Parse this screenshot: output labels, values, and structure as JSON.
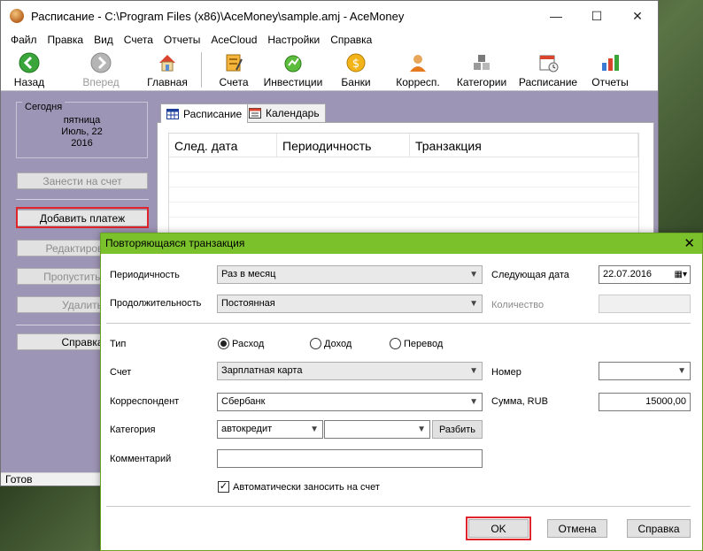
{
  "window": {
    "title": "Расписание - C:\\Program Files (x86)\\AceMoney\\sample.amj - AceMoney",
    "minimize": "—",
    "maximize": "☐",
    "close": "✕"
  },
  "menu": [
    "Файл",
    "Правка",
    "Вид",
    "Счета",
    "Отчеты",
    "AceCloud",
    "Настройки",
    "Справка"
  ],
  "toolbar": {
    "back": "Назад",
    "forward": "Вперед",
    "home": "Главная",
    "accounts": "Счета",
    "investments": "Инвестиции",
    "banks": "Банки",
    "payees": "Корресп.",
    "categories": "Категории",
    "schedule": "Расписание",
    "reports": "Отчеты"
  },
  "left_panel": {
    "today_label": "Сегодня",
    "weekday": "пятница",
    "date_line": "Июль, 22",
    "year": "2016",
    "enter_button": "Занести на счет",
    "add_payment_button": "Добавить платеж",
    "edit_button": "Редактировать",
    "skip_button": "Пропустить пла",
    "delete_button": "Удалить",
    "help_button": "Справка"
  },
  "tabs": {
    "schedule": "Расписание",
    "calendar": "Календарь"
  },
  "list": {
    "columns": [
      "След. дата",
      "Периодичность",
      "Транзакция"
    ]
  },
  "statusbar": {
    "text": "Готов"
  },
  "dialog": {
    "title": "Повторяющаяся транзакция",
    "close": "✕",
    "periodicity_label": "Периодичность",
    "periodicity_value": "Раз в месяц",
    "duration_label": "Продолжительность",
    "duration_value": "Постоянная",
    "next_date_label": "Следующая дата",
    "next_date_value": "22.07.2016",
    "count_label": "Количество",
    "type_label": "Тип",
    "type_options": [
      "Расход",
      "Доход",
      "Перевод"
    ],
    "account_label": "Счет",
    "account_value": "Зарплатная карта",
    "number_label": "Номер",
    "payee_label": "Корреспондент",
    "payee_value": "Сбербанк",
    "amount_label": "Сумма, RUB",
    "amount_value": "15000,00",
    "category_label": "Категория",
    "category_value": "автокредит",
    "split_button": "Разбить",
    "comment_label": "Комментарий",
    "auto_enter_label": "Автоматически заносить на счет",
    "auto_enter_checked": true,
    "ok_button": "OK",
    "cancel_button": "Отмена",
    "help_button": "Справка"
  },
  "colors": {
    "accent_green": "#7bc12c",
    "highlight_red": "#e0242c",
    "panel_purple": "#9d95b5"
  }
}
